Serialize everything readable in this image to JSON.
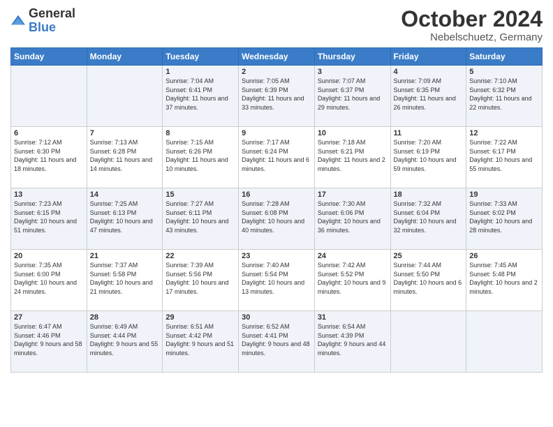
{
  "logo": {
    "general": "General",
    "blue": "Blue"
  },
  "header": {
    "month": "October 2024",
    "location": "Nebelschuetz, Germany"
  },
  "days_of_week": [
    "Sunday",
    "Monday",
    "Tuesday",
    "Wednesday",
    "Thursday",
    "Friday",
    "Saturday"
  ],
  "weeks": [
    [
      {
        "day": "",
        "sunrise": "",
        "sunset": "",
        "daylight": ""
      },
      {
        "day": "",
        "sunrise": "",
        "sunset": "",
        "daylight": ""
      },
      {
        "day": "1",
        "sunrise": "Sunrise: 7:04 AM",
        "sunset": "Sunset: 6:41 PM",
        "daylight": "Daylight: 11 hours and 37 minutes."
      },
      {
        "day": "2",
        "sunrise": "Sunrise: 7:05 AM",
        "sunset": "Sunset: 6:39 PM",
        "daylight": "Daylight: 11 hours and 33 minutes."
      },
      {
        "day": "3",
        "sunrise": "Sunrise: 7:07 AM",
        "sunset": "Sunset: 6:37 PM",
        "daylight": "Daylight: 11 hours and 29 minutes."
      },
      {
        "day": "4",
        "sunrise": "Sunrise: 7:09 AM",
        "sunset": "Sunset: 6:35 PM",
        "daylight": "Daylight: 11 hours and 26 minutes."
      },
      {
        "day": "5",
        "sunrise": "Sunrise: 7:10 AM",
        "sunset": "Sunset: 6:32 PM",
        "daylight": "Daylight: 11 hours and 22 minutes."
      }
    ],
    [
      {
        "day": "6",
        "sunrise": "Sunrise: 7:12 AM",
        "sunset": "Sunset: 6:30 PM",
        "daylight": "Daylight: 11 hours and 18 minutes."
      },
      {
        "day": "7",
        "sunrise": "Sunrise: 7:13 AM",
        "sunset": "Sunset: 6:28 PM",
        "daylight": "Daylight: 11 hours and 14 minutes."
      },
      {
        "day": "8",
        "sunrise": "Sunrise: 7:15 AM",
        "sunset": "Sunset: 6:26 PM",
        "daylight": "Daylight: 11 hours and 10 minutes."
      },
      {
        "day": "9",
        "sunrise": "Sunrise: 7:17 AM",
        "sunset": "Sunset: 6:24 PM",
        "daylight": "Daylight: 11 hours and 6 minutes."
      },
      {
        "day": "10",
        "sunrise": "Sunrise: 7:18 AM",
        "sunset": "Sunset: 6:21 PM",
        "daylight": "Daylight: 11 hours and 2 minutes."
      },
      {
        "day": "11",
        "sunrise": "Sunrise: 7:20 AM",
        "sunset": "Sunset: 6:19 PM",
        "daylight": "Daylight: 10 hours and 59 minutes."
      },
      {
        "day": "12",
        "sunrise": "Sunrise: 7:22 AM",
        "sunset": "Sunset: 6:17 PM",
        "daylight": "Daylight: 10 hours and 55 minutes."
      }
    ],
    [
      {
        "day": "13",
        "sunrise": "Sunrise: 7:23 AM",
        "sunset": "Sunset: 6:15 PM",
        "daylight": "Daylight: 10 hours and 51 minutes."
      },
      {
        "day": "14",
        "sunrise": "Sunrise: 7:25 AM",
        "sunset": "Sunset: 6:13 PM",
        "daylight": "Daylight: 10 hours and 47 minutes."
      },
      {
        "day": "15",
        "sunrise": "Sunrise: 7:27 AM",
        "sunset": "Sunset: 6:11 PM",
        "daylight": "Daylight: 10 hours and 43 minutes."
      },
      {
        "day": "16",
        "sunrise": "Sunrise: 7:28 AM",
        "sunset": "Sunset: 6:08 PM",
        "daylight": "Daylight: 10 hours and 40 minutes."
      },
      {
        "day": "17",
        "sunrise": "Sunrise: 7:30 AM",
        "sunset": "Sunset: 6:06 PM",
        "daylight": "Daylight: 10 hours and 36 minutes."
      },
      {
        "day": "18",
        "sunrise": "Sunrise: 7:32 AM",
        "sunset": "Sunset: 6:04 PM",
        "daylight": "Daylight: 10 hours and 32 minutes."
      },
      {
        "day": "19",
        "sunrise": "Sunrise: 7:33 AM",
        "sunset": "Sunset: 6:02 PM",
        "daylight": "Daylight: 10 hours and 28 minutes."
      }
    ],
    [
      {
        "day": "20",
        "sunrise": "Sunrise: 7:35 AM",
        "sunset": "Sunset: 6:00 PM",
        "daylight": "Daylight: 10 hours and 24 minutes."
      },
      {
        "day": "21",
        "sunrise": "Sunrise: 7:37 AM",
        "sunset": "Sunset: 5:58 PM",
        "daylight": "Daylight: 10 hours and 21 minutes."
      },
      {
        "day": "22",
        "sunrise": "Sunrise: 7:39 AM",
        "sunset": "Sunset: 5:56 PM",
        "daylight": "Daylight: 10 hours and 17 minutes."
      },
      {
        "day": "23",
        "sunrise": "Sunrise: 7:40 AM",
        "sunset": "Sunset: 5:54 PM",
        "daylight": "Daylight: 10 hours and 13 minutes."
      },
      {
        "day": "24",
        "sunrise": "Sunrise: 7:42 AM",
        "sunset": "Sunset: 5:52 PM",
        "daylight": "Daylight: 10 hours and 9 minutes."
      },
      {
        "day": "25",
        "sunrise": "Sunrise: 7:44 AM",
        "sunset": "Sunset: 5:50 PM",
        "daylight": "Daylight: 10 hours and 6 minutes."
      },
      {
        "day": "26",
        "sunrise": "Sunrise: 7:45 AM",
        "sunset": "Sunset: 5:48 PM",
        "daylight": "Daylight: 10 hours and 2 minutes."
      }
    ],
    [
      {
        "day": "27",
        "sunrise": "Sunrise: 6:47 AM",
        "sunset": "Sunset: 4:46 PM",
        "daylight": "Daylight: 9 hours and 58 minutes."
      },
      {
        "day": "28",
        "sunrise": "Sunrise: 6:49 AM",
        "sunset": "Sunset: 4:44 PM",
        "daylight": "Daylight: 9 hours and 55 minutes."
      },
      {
        "day": "29",
        "sunrise": "Sunrise: 6:51 AM",
        "sunset": "Sunset: 4:42 PM",
        "daylight": "Daylight: 9 hours and 51 minutes."
      },
      {
        "day": "30",
        "sunrise": "Sunrise: 6:52 AM",
        "sunset": "Sunset: 4:41 PM",
        "daylight": "Daylight: 9 hours and 48 minutes."
      },
      {
        "day": "31",
        "sunrise": "Sunrise: 6:54 AM",
        "sunset": "Sunset: 4:39 PM",
        "daylight": "Daylight: 9 hours and 44 minutes."
      },
      {
        "day": "",
        "sunrise": "",
        "sunset": "",
        "daylight": ""
      },
      {
        "day": "",
        "sunrise": "",
        "sunset": "",
        "daylight": ""
      }
    ]
  ]
}
